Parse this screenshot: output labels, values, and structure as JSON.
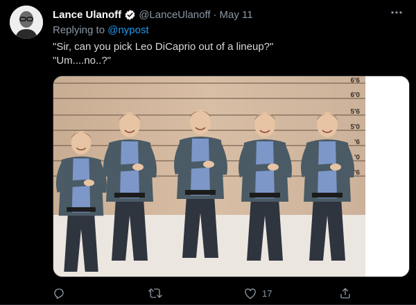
{
  "author": {
    "name": "Lance Ulanoff",
    "handle": "@LanceUlanoff",
    "separator": "·",
    "date": "May 11"
  },
  "reply": {
    "prefix": "Replying to ",
    "mention": "@nypost"
  },
  "tweet_text": {
    "line1": "\"Sir, can you pick Leo DiCaprio out of a lineup?\"",
    "line2": "\"Um....no..?\""
  },
  "media": {
    "height_labels": [
      "6'6",
      "6'0",
      "5'6",
      "5'0",
      "'6",
      "'0",
      "'6"
    ]
  },
  "actions": {
    "reply_count": "",
    "retweet_count": "",
    "like_count": "17",
    "share_count": ""
  },
  "colors": {
    "background": "#000000",
    "text": "#d9d9d9",
    "muted": "#8b98a5",
    "link": "#1d9bf0",
    "verified": "#1d9bf0"
  },
  "icons": {
    "more": "more-horizontal-icon",
    "verified": "verified-badge-icon",
    "reply": "reply-icon",
    "retweet": "retweet-icon",
    "like": "heart-icon",
    "share": "share-icon"
  }
}
